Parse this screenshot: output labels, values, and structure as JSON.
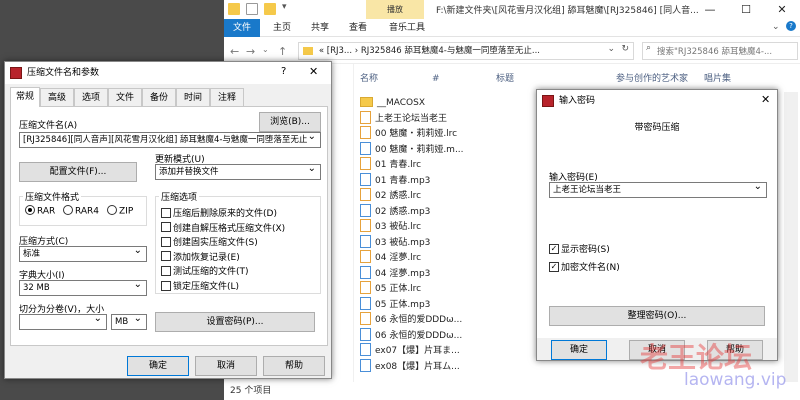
{
  "explorer": {
    "context_tab": "播放",
    "title": "F:\\新建文件夹\\[风花雪月汉化组] 舔耳魅魔\\[RJ325846] [同人音...",
    "ribbon_tabs": [
      "文件",
      "主页",
      "共享",
      "查看",
      "音乐工具"
    ],
    "address_text": "«  [RJ3...  ›  RJ325846 舔耳魅魔4-与魅魔一同堕落至无止...",
    "search_placeholder": "搜索\"RJ325846 舔耳魅魔4-...",
    "columns": [
      "名称",
      "#",
      "标题",
      "参与创作的艺术家",
      "唱片集"
    ],
    "files": [
      {
        "name": "__MACOSX",
        "type": "folder"
      },
      {
        "name": "上老王论坛当老王",
        "type": "file"
      },
      {
        "name": "00 魅魔・莉莉娅.lrc",
        "type": "file"
      },
      {
        "name": "00 魅魔・莉莉娅.m...",
        "type": "audio"
      },
      {
        "name": "01 青春.lrc",
        "type": "file"
      },
      {
        "name": "01 青春.mp3",
        "type": "audio"
      },
      {
        "name": "02 誘惑.lrc",
        "type": "file"
      },
      {
        "name": "02 誘惑.mp3",
        "type": "audio"
      },
      {
        "name": "03 被砧.lrc",
        "type": "file"
      },
      {
        "name": "03 被砧.mp3",
        "type": "audio"
      },
      {
        "name": "04 淫夢.lrc",
        "type": "file"
      },
      {
        "name": "04 淫夢.mp3",
        "type": "audio"
      },
      {
        "name": "05 正体.lrc",
        "type": "file"
      },
      {
        "name": "05 正体.mp3",
        "type": "audio"
      },
      {
        "name": "06 永恒的爱DDDω...",
        "type": "file"
      },
      {
        "name": "06 永恒的爱DDDω...",
        "type": "audio"
      },
      {
        "name": "ex07【爆】片耳ま...",
        "type": "audio"
      },
      {
        "name": "ex08【爆】片耳ム...",
        "type": "audio"
      }
    ],
    "status": "25 个项目"
  },
  "rar_dialog": {
    "title": "压缩文件名和参数",
    "help_glyph": "?",
    "tabs": [
      "常规",
      "高级",
      "选项",
      "文件",
      "备份",
      "时间",
      "注释"
    ],
    "archive_name_label": "压缩文件名(A)",
    "browse_button": "浏览(B)...",
    "archive_name_value": "[RJ325846][同人音声][风花雪月汉化组] 舔耳魅魔4-与魅魔一同堕落至无止",
    "profile_button": "配置文件(F)...",
    "update_mode_label": "更新模式(U)",
    "update_mode_value": "添加并替换文件",
    "format_label": "压缩文件格式",
    "formats": [
      "RAR",
      "RAR4",
      "ZIP"
    ],
    "method_label": "压缩方式(C)",
    "method_value": "标准",
    "dict_label": "字典大小(I)",
    "dict_value": "32 MB",
    "split_label": "切分为分卷(V)，大小",
    "split_unit": "MB",
    "options_label": "压缩选项",
    "options": [
      {
        "label": "压缩后删除原来的文件(D)",
        "checked": false
      },
      {
        "label": "创建自解压格式压缩文件(X)",
        "checked": false
      },
      {
        "label": "创建固实压缩文件(S)",
        "checked": false
      },
      {
        "label": "添加恢复记录(E)",
        "checked": false
      },
      {
        "label": "测试压缩的文件(T)",
        "checked": false
      },
      {
        "label": "锁定压缩文件(L)",
        "checked": false
      }
    ],
    "set_password_button": "设置密码(P)...",
    "ok": "确定",
    "cancel": "取消",
    "help": "帮助"
  },
  "pwd_dialog": {
    "title": "输入密码",
    "heading": "带密码压缩",
    "password_label": "输入密码(E)",
    "password_value": "上老王论坛当老王",
    "show_password": "显示密码(S)",
    "encrypt_names": "加密文件名(N)",
    "organize_button": "整理密码(O)...",
    "ok": "确定",
    "cancel": "取消",
    "help": "帮助"
  },
  "watermark": {
    "line1": "老王论坛",
    "line2": "laowang.vip"
  }
}
